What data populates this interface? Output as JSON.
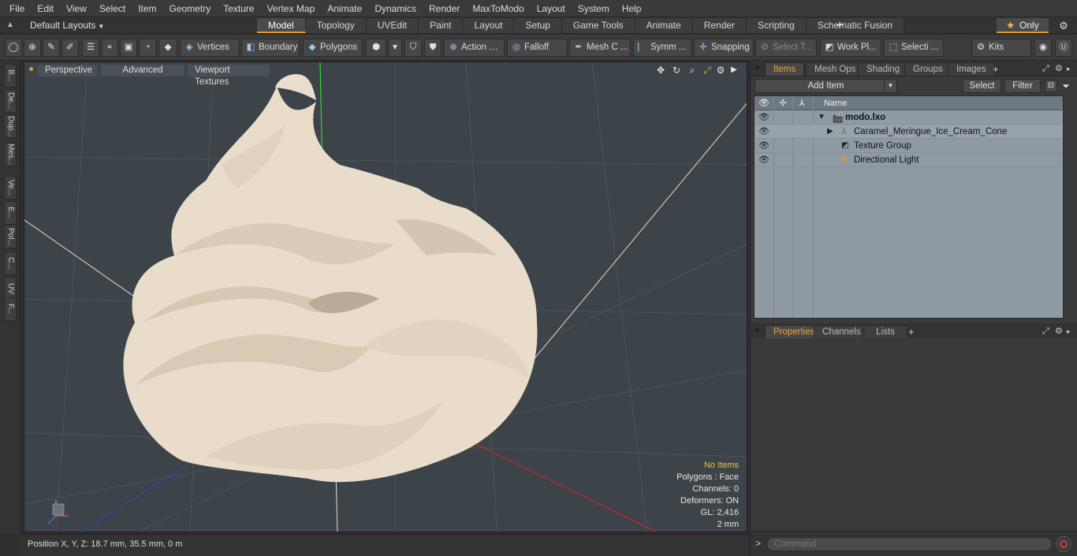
{
  "menu": [
    "File",
    "Edit",
    "View",
    "Select",
    "Item",
    "Geometry",
    "Texture",
    "Vertex Map",
    "Animate",
    "Dynamics",
    "Render",
    "MaxToModo",
    "Layout",
    "System",
    "Help"
  ],
  "layout": {
    "dropdown_label": "Default Layouts",
    "tabs": [
      "Model",
      "Topology",
      "UVEdit",
      "Paint",
      "Layout",
      "Setup",
      "Game Tools",
      "Animate",
      "Render",
      "Scripting",
      "Schematic Fusion"
    ],
    "active_tab": "Model",
    "plus_label": "+",
    "only_label": "Only"
  },
  "toolbar": {
    "vertices": "Vertices",
    "boundary": "Boundary",
    "polygons": "Polygons",
    "action": "Action",
    "falloff": "Falloff",
    "mesh_c": "Mesh C ...",
    "symm": "Symm ...",
    "snapping": "Snapping",
    "select_t": "Select T...",
    "work_pl": "Work Pl...",
    "selecti": "Selecti ...",
    "kits": "Kits"
  },
  "left_tabs": [
    "B...",
    "De...",
    "Dup...",
    "Mes...",
    "Ve...",
    "E...",
    "Pol...",
    "C...",
    "UV",
    "F..."
  ],
  "viewport": {
    "perspective": "Perspective",
    "advanced": "Advanced",
    "viewport_textures": "Viewport Textures",
    "info": {
      "no_items": "No Items",
      "polygons": "Polygons : Face",
      "channels": "Channels: 0",
      "deformers": "Deformers: ON",
      "gl": "GL: 2,416",
      "scale": "2 mm"
    }
  },
  "status": {
    "position": "Position X, Y, Z:  18.7 mm, 35.5 mm, 0 m"
  },
  "items_panel": {
    "tabs": [
      "Items",
      "Mesh Ops",
      "Shading",
      "Groups",
      "Images"
    ],
    "active_tab": "Items",
    "add_item": "Add Item",
    "select": "Select",
    "filter": "Filter",
    "column_name": "Name",
    "rows": [
      {
        "label": "modo.lxo",
        "bold": true
      },
      {
        "label": "Caramel_Meringue_Ice_Cream_Cone",
        "bold": false
      },
      {
        "label": "Texture Group",
        "bold": false
      },
      {
        "label": "Directional Light",
        "bold": false
      }
    ]
  },
  "props_panel": {
    "tabs": [
      "Properties",
      "Channels",
      "Lists"
    ],
    "active_tab": "Properties"
  },
  "command": {
    "placeholder": "Command"
  },
  "colors": {
    "accent": "#e39b2c",
    "viewport_bg": "#3c4349",
    "meringue": "#e9dccb",
    "item_list_bg": "#8f9aa3"
  }
}
